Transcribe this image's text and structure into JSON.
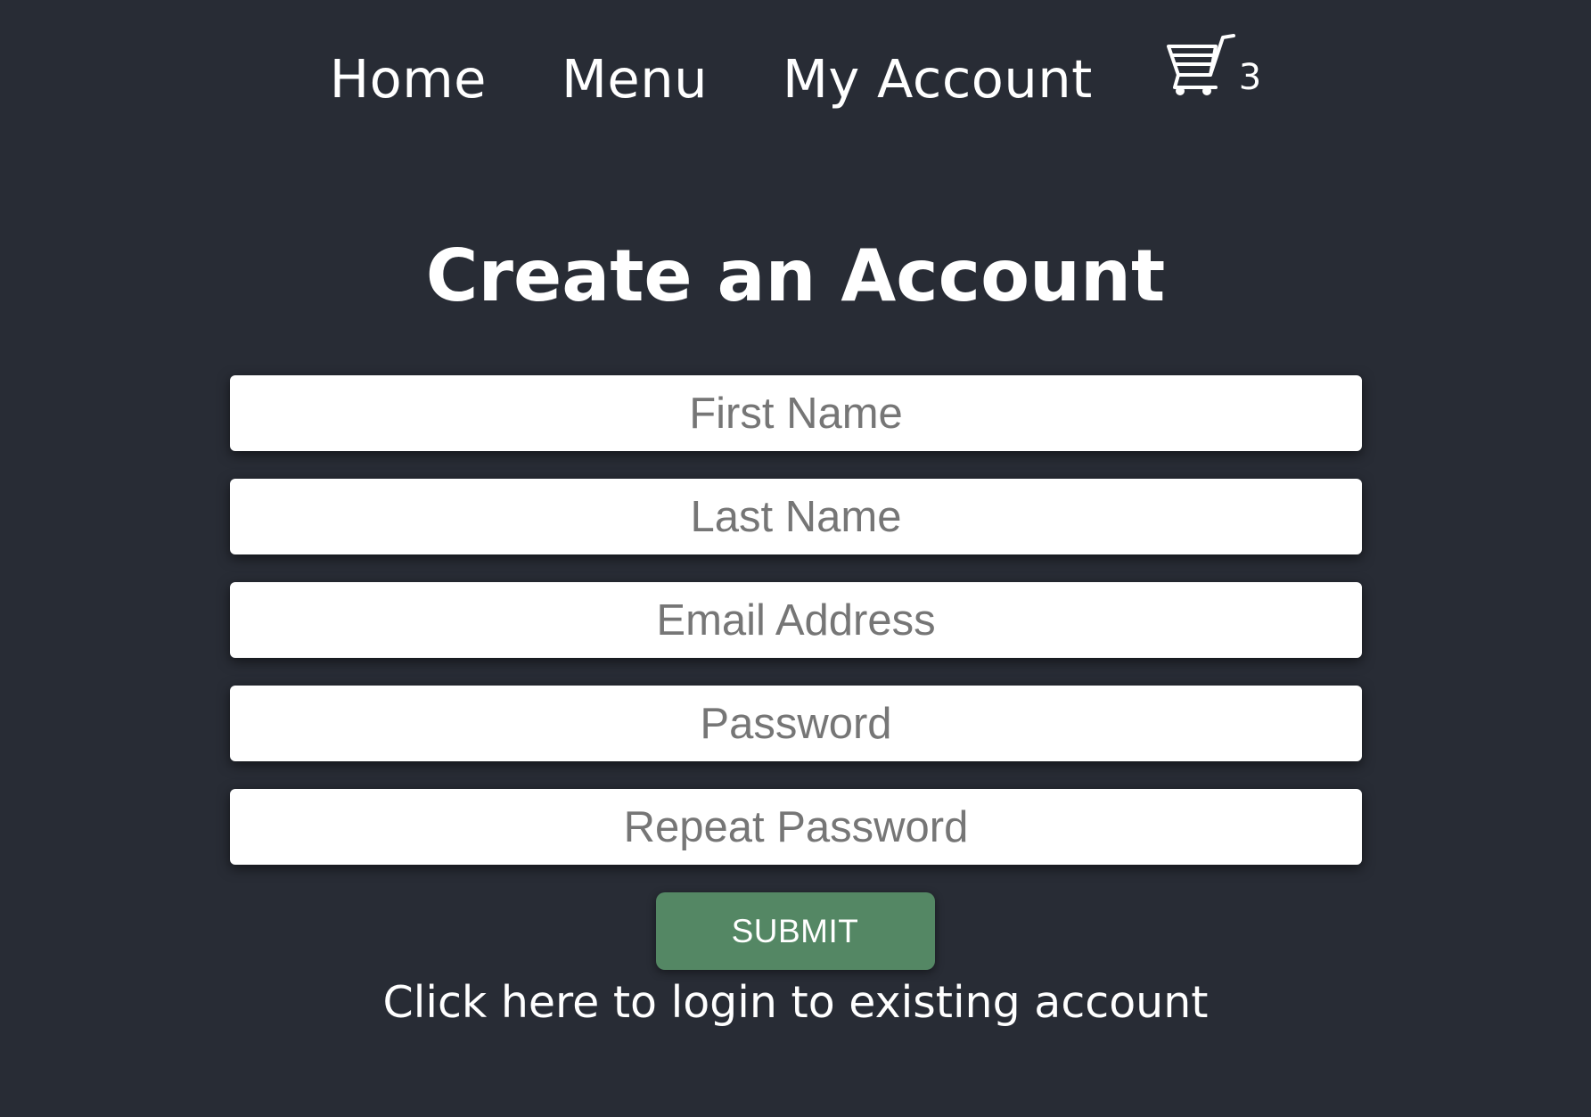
{
  "nav": {
    "items": [
      {
        "label": "Home"
      },
      {
        "label": "Menu"
      },
      {
        "label": "My Account"
      }
    ],
    "cart": {
      "icon": "shopping-cart-icon",
      "count": "3"
    }
  },
  "main": {
    "title": "Create an Account",
    "fields": {
      "first_name": {
        "placeholder": "First Name",
        "value": ""
      },
      "last_name": {
        "placeholder": "Last Name",
        "value": ""
      },
      "email": {
        "placeholder": "Email Address",
        "value": ""
      },
      "password": {
        "placeholder": "Password",
        "value": ""
      },
      "repeat_password": {
        "placeholder": "Repeat Password",
        "value": ""
      }
    },
    "submit_label": "SUBMIT",
    "login_link": "Click here to login to existing account"
  },
  "colors": {
    "background": "#282c35",
    "submit_button": "#548764",
    "field_background": "#ffffff",
    "placeholder_text": "#767676",
    "text": "#ffffff"
  }
}
